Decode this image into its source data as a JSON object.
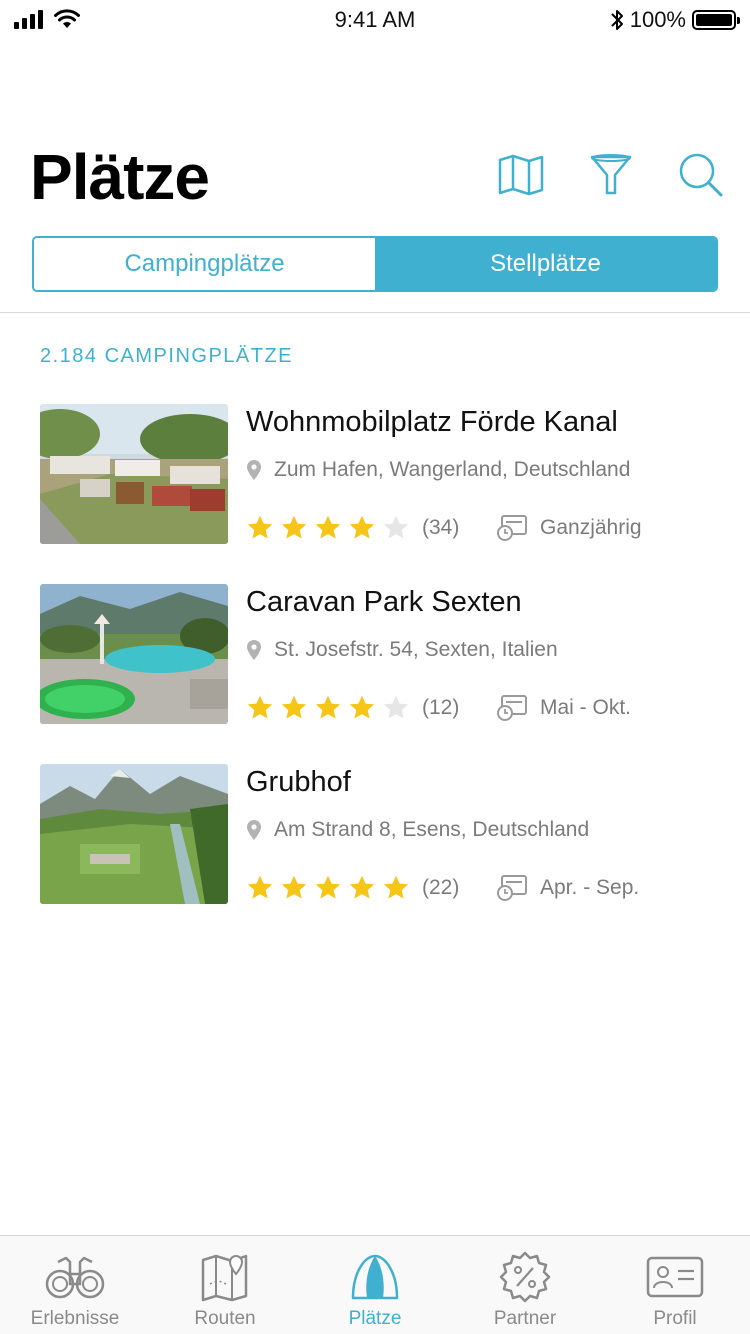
{
  "status_bar": {
    "time": "9:41 AM",
    "battery": "100%"
  },
  "header": {
    "title": "Plätze",
    "icons": [
      "map-icon",
      "filter-icon",
      "search-icon"
    ]
  },
  "segmented": {
    "options": [
      "Campingplätze",
      "Stellplätze"
    ],
    "selected": "Stellplätze"
  },
  "count_label": "2.184 CAMPINGPLÄTZE",
  "places": [
    {
      "name": "Wohnmobilplatz Förde Kanal",
      "address": "Zum Hafen, Wangerland, Deutschland",
      "rating": 4,
      "reviews": "(34)",
      "season": "Ganzjährig",
      "image": "caravan-site-photo"
    },
    {
      "name": "Caravan Park Sexten",
      "address": "St. Josefstr. 54, Sexten, Italien",
      "rating": 4,
      "reviews": "(12)",
      "season": "Mai - Okt.",
      "image": "pool-photo"
    },
    {
      "name": "Grubhof",
      "address": "Am Strand 8, Esens, Deutschland",
      "rating": 5,
      "reviews": "(22)",
      "season": "Apr. - Sep.",
      "image": "mountain-valley-photo"
    }
  ],
  "tabbar": {
    "tabs": [
      {
        "label": "Erlebnisse",
        "icon": "binoculars-icon"
      },
      {
        "label": "Routen",
        "icon": "route-map-icon"
      },
      {
        "label": "Plätze",
        "icon": "tent-icon"
      },
      {
        "label": "Partner",
        "icon": "percent-badge-icon"
      },
      {
        "label": "Profil",
        "icon": "id-card-icon"
      }
    ],
    "active": "Plätze"
  },
  "colors": {
    "accent": "#3fb0d0",
    "star": "#f5c518",
    "star_empty": "#e6e6e6",
    "muted_text": "#7b7b7b"
  }
}
